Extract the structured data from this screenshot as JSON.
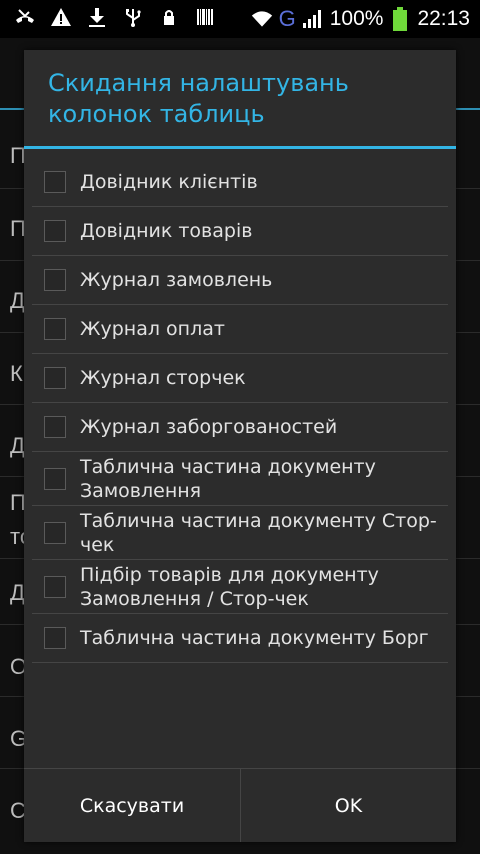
{
  "status_bar": {
    "icons_left": [
      "missed-call-icon",
      "warning-icon",
      "download-icon",
      "usb-icon",
      "lock-icon",
      "barcode-icon"
    ],
    "network_type": "G",
    "battery": "100%",
    "time": "22:13"
  },
  "background": {
    "items": [
      "П",
      "П",
      "Д",
      "К",
      "Д",
      "П",
      "то",
      "Д",
      "О",
      "G",
      "С"
    ]
  },
  "dialog": {
    "title": "Скидання налаштувань колонок таблиць",
    "options": [
      {
        "label": "Довідник клієнтів",
        "checked": false
      },
      {
        "label": "Довідник товарів",
        "checked": false
      },
      {
        "label": "Журнал замовлень",
        "checked": false
      },
      {
        "label": "Журнал оплат",
        "checked": false
      },
      {
        "label": "Журнал сторчек",
        "checked": false
      },
      {
        "label": "Журнал заборгованостей",
        "checked": false
      },
      {
        "label": "Таблична частина документу Замовлення",
        "checked": false
      },
      {
        "label": "Таблична частина документу Стор-чек",
        "checked": false
      },
      {
        "label": "Підбір товарів для документу Замовлення / Стор-чек",
        "checked": false
      },
      {
        "label": "Таблична частина документу Борг",
        "checked": false
      }
    ],
    "cancel_label": "Скасувати",
    "ok_label": "OK"
  },
  "colors": {
    "accent": "#33b5e5",
    "dialog_bg": "#2c2c2c",
    "network_g": "#5b6fd8",
    "battery": "#6fd83a"
  }
}
